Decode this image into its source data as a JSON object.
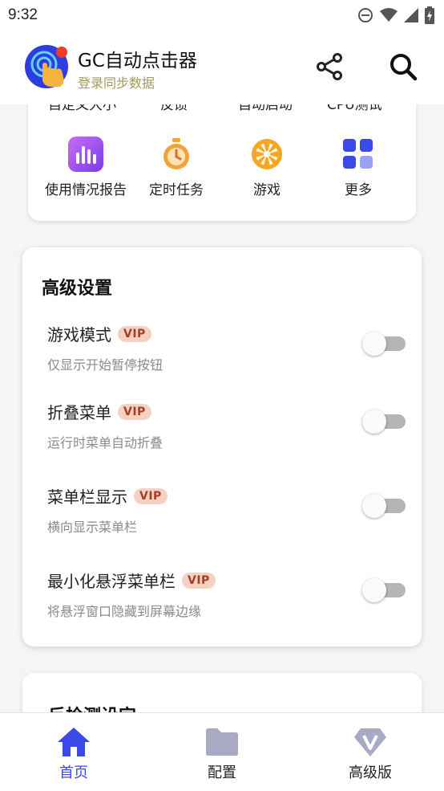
{
  "status": {
    "time": "9:32"
  },
  "app": {
    "title": "GC自动点击器",
    "subtitle": "登录同步数据"
  },
  "colors": {
    "accent": "#3a49e8",
    "vip_bg": "#f6d0c1",
    "vip_text": "#a0402a",
    "subtitle": "#a39a5c"
  },
  "shortcuts": {
    "clipped_labels": [
      "自定义大小",
      "反馈",
      "自动启动",
      "CPU测试"
    ],
    "items": [
      {
        "label": "使用情况报告",
        "icon": "bar-chart-icon"
      },
      {
        "label": "定时任务",
        "icon": "stopwatch-icon"
      },
      {
        "label": "游戏",
        "icon": "wheel-icon"
      },
      {
        "label": "更多",
        "icon": "grid-icon"
      }
    ]
  },
  "advanced": {
    "title": "高级设置",
    "badge": "VIP",
    "settings": [
      {
        "name": "游戏模式",
        "desc": "仅显示开始暂停按钮",
        "enabled": false
      },
      {
        "name": "折叠菜单",
        "desc": "运行时菜单自动折叠",
        "enabled": false
      },
      {
        "name": "菜单栏显示",
        "desc": "横向显示菜单栏",
        "enabled": false
      },
      {
        "name": "最小化悬浮菜单栏",
        "desc": "将悬浮窗口隐藏到屏幕边缘",
        "enabled": false
      }
    ]
  },
  "detect": {
    "title": "反检测设定"
  },
  "nav": {
    "items": [
      {
        "label": "首页",
        "icon": "home-icon",
        "active": true
      },
      {
        "label": "配置",
        "icon": "folder-icon",
        "active": false
      },
      {
        "label": "高级版",
        "icon": "diamond-v-icon",
        "active": false
      }
    ]
  }
}
